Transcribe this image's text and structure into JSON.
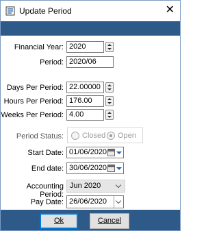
{
  "window": {
    "title": "Update Period",
    "close_label": "✕"
  },
  "form": {
    "financial_year": {
      "label": "Financial Year:",
      "value": "2020"
    },
    "period": {
      "label": "Period:",
      "value": "2020/06"
    },
    "days_per_period": {
      "label": "Days Per Period:",
      "value": "22.00000"
    },
    "hours_per_period": {
      "label": "Hours Per Period:",
      "value": "176.00"
    },
    "weeks_per_period": {
      "label": "Weeks Per Period:",
      "value": "4.00"
    },
    "period_status": {
      "label": "Period Status:",
      "options": [
        "Closed",
        "Open"
      ],
      "selected": "Open"
    },
    "start_date": {
      "label": "Start Date:",
      "value": "01/06/2020"
    },
    "end_date": {
      "label": "End date:",
      "value": "30/06/2020"
    },
    "accounting_period": {
      "label": "Accounting Period:",
      "value": "Jun 2020"
    },
    "pay_date": {
      "label": "Pay Date:",
      "value": "26/06/2020"
    }
  },
  "buttons": {
    "ok": "Ok",
    "cancel": "Cancel"
  },
  "colors": {
    "band": "#2e5a8a",
    "default_button_border": "#0078d7"
  }
}
